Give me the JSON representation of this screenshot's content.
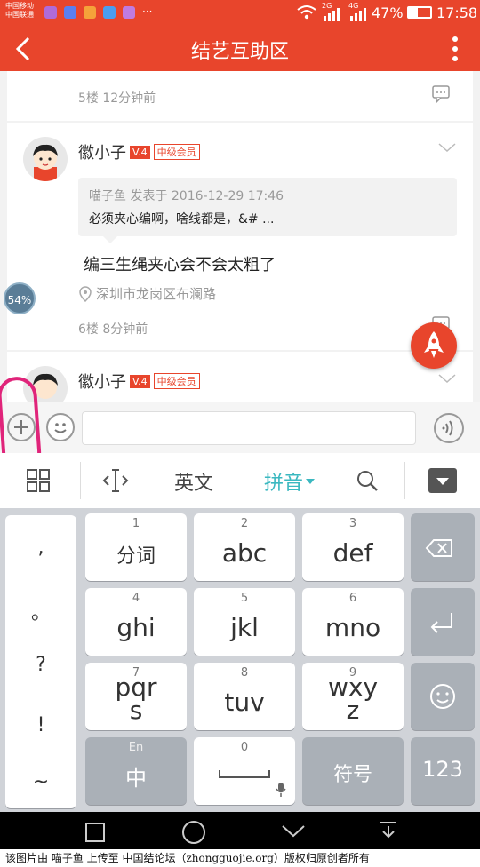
{
  "status": {
    "carrier1": "中国移动",
    "carrier2": "中国联通",
    "battery": "47%",
    "time": "17:58",
    "net1": "2G",
    "net2": "4G",
    "dots": "···"
  },
  "title": "结艺互助区",
  "floor5": {
    "meta": "5楼 12分钟前"
  },
  "post6": {
    "user": "徽小子",
    "level": "V.4",
    "rank": "中级会员",
    "quote_header": "喵子鱼 发表于 2016-12-29 17:46",
    "quote_body": "必须夹心编啊，啥线都是，&# ...",
    "content": "编三生绳夹心会不会太粗了",
    "location": "深圳市龙岗区布澜路",
    "meta": "6楼 8分钟前"
  },
  "post7": {
    "user": "徽小子",
    "level": "V.4",
    "rank": "中级会员"
  },
  "progress": "54%",
  "progress_symbol": "%",
  "progress_value": 54,
  "input_placeholder": "",
  "kb_toolbar": {
    "english": "英文",
    "pinyin": "拼音"
  },
  "kb_left": [
    ",",
    "。",
    "?",
    "!",
    "~"
  ],
  "keys": [
    {
      "num": "1",
      "label": "分词"
    },
    {
      "num": "2",
      "label": "abc"
    },
    {
      "num": "3",
      "label": "def"
    },
    {
      "num": "4",
      "label": "ghi"
    },
    {
      "num": "5",
      "label": "jkl"
    },
    {
      "num": "6",
      "label": "mno"
    },
    {
      "num": "7",
      "label": "pqr"
    },
    {
      "num": "8",
      "label": "tuv"
    },
    {
      "num": "9",
      "label": "wxy"
    }
  ],
  "key7_extra": "s",
  "key9_extra": "z",
  "key_zh": {
    "top": "En",
    "label": "中"
  },
  "key_space_num": "0",
  "key_symbols": "符号",
  "key_123": "123",
  "credit": "该图片由 喵子鱼 上传至 中国结论坛（zhongguojie.org）版权归原创者所有",
  "colors": {
    "brand": "#e8452c",
    "accent_teal": "#3bb8c0",
    "highlight_pink": "#e0247a"
  }
}
